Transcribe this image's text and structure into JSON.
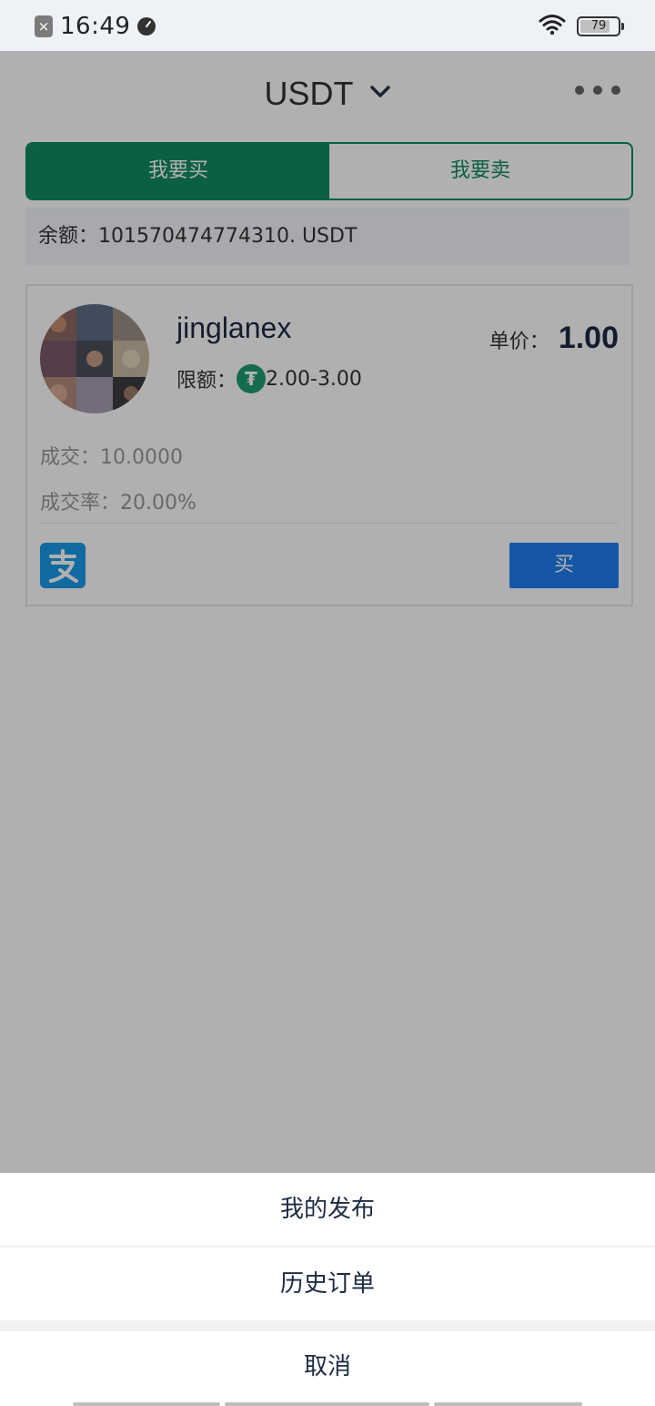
{
  "status_bar": {
    "notification_glyph": "×",
    "time": "16:49",
    "battery": "79",
    "battery_level": 0.79
  },
  "header": {
    "title": "USDT",
    "more_icon": "more-dots-icon",
    "dropdown_icon": "chevron-down-icon"
  },
  "tabs": {
    "buy": "我要买",
    "sell": "我要卖",
    "active": "buy"
  },
  "balance": {
    "text": "余额：101570474774310. USDT"
  },
  "listing": {
    "name": "jinglanex",
    "limit_label": "限额：",
    "limit_value": "2.00-3.00",
    "price_label": "单价：",
    "price_value": "1.00",
    "trades": "成交：10.0000",
    "rate": "成交率：20.00%",
    "payment_icon": "alipay-icon",
    "buy_button": "买"
  },
  "action_sheet": {
    "items": [
      "我的发布",
      "历史订单"
    ],
    "cancel": "取消"
  },
  "colors": {
    "accent_green": "#0f8a63",
    "buy_blue": "#1f7ef0",
    "alipay_blue": "#1a9be8",
    "tether_green": "#1f9b74"
  }
}
